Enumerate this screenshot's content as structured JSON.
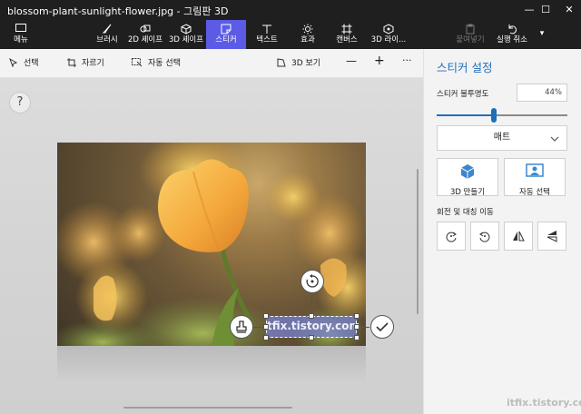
{
  "window": {
    "title": "blossom-plant-sunlight-flower.jpg - 그림판 3D",
    "minimize": "—",
    "maximize": "☐",
    "close": "✕"
  },
  "toolbar": {
    "menu": "메뉴",
    "tools": [
      {
        "label": "브러시",
        "icon": "brush-icon"
      },
      {
        "label": "2D 셰이프",
        "icon": "2d-shape-icon"
      },
      {
        "label": "3D 셰이프",
        "icon": "3d-shape-icon"
      },
      {
        "label": "스티커",
        "icon": "sticker-icon",
        "active": true
      },
      {
        "label": "텍스트",
        "icon": "text-icon"
      },
      {
        "label": "효과",
        "icon": "effects-icon"
      },
      {
        "label": "캔버스",
        "icon": "canvas-icon"
      },
      {
        "label": "3D 라이...",
        "icon": "3d-library-icon"
      }
    ],
    "paste": "붙여넣기",
    "undo": "실행 취소",
    "more": "▾",
    "active_color": "#5b5be6"
  },
  "subbar": {
    "select": "선택",
    "crop": "자르기",
    "magic_select": "자동 선택",
    "view_3d": "3D 보기",
    "zoom_out": "—",
    "zoom_in": "+",
    "more": "···"
  },
  "canvas": {
    "help": "?",
    "sticker_text": "tfix.tistory.com"
  },
  "panel": {
    "title": "스티커 설정",
    "opacity_label": "스티커 불투명도",
    "opacity_value": "44%",
    "opacity_fraction": 0.44,
    "finish_value": "매트",
    "make_3d": "3D 만들기",
    "auto_select": "자동 선택",
    "rotate_flip_label": "회전 및 대칭 이동",
    "accent_color": "#1f6fb8"
  },
  "watermark": "itfix.tistory.com"
}
